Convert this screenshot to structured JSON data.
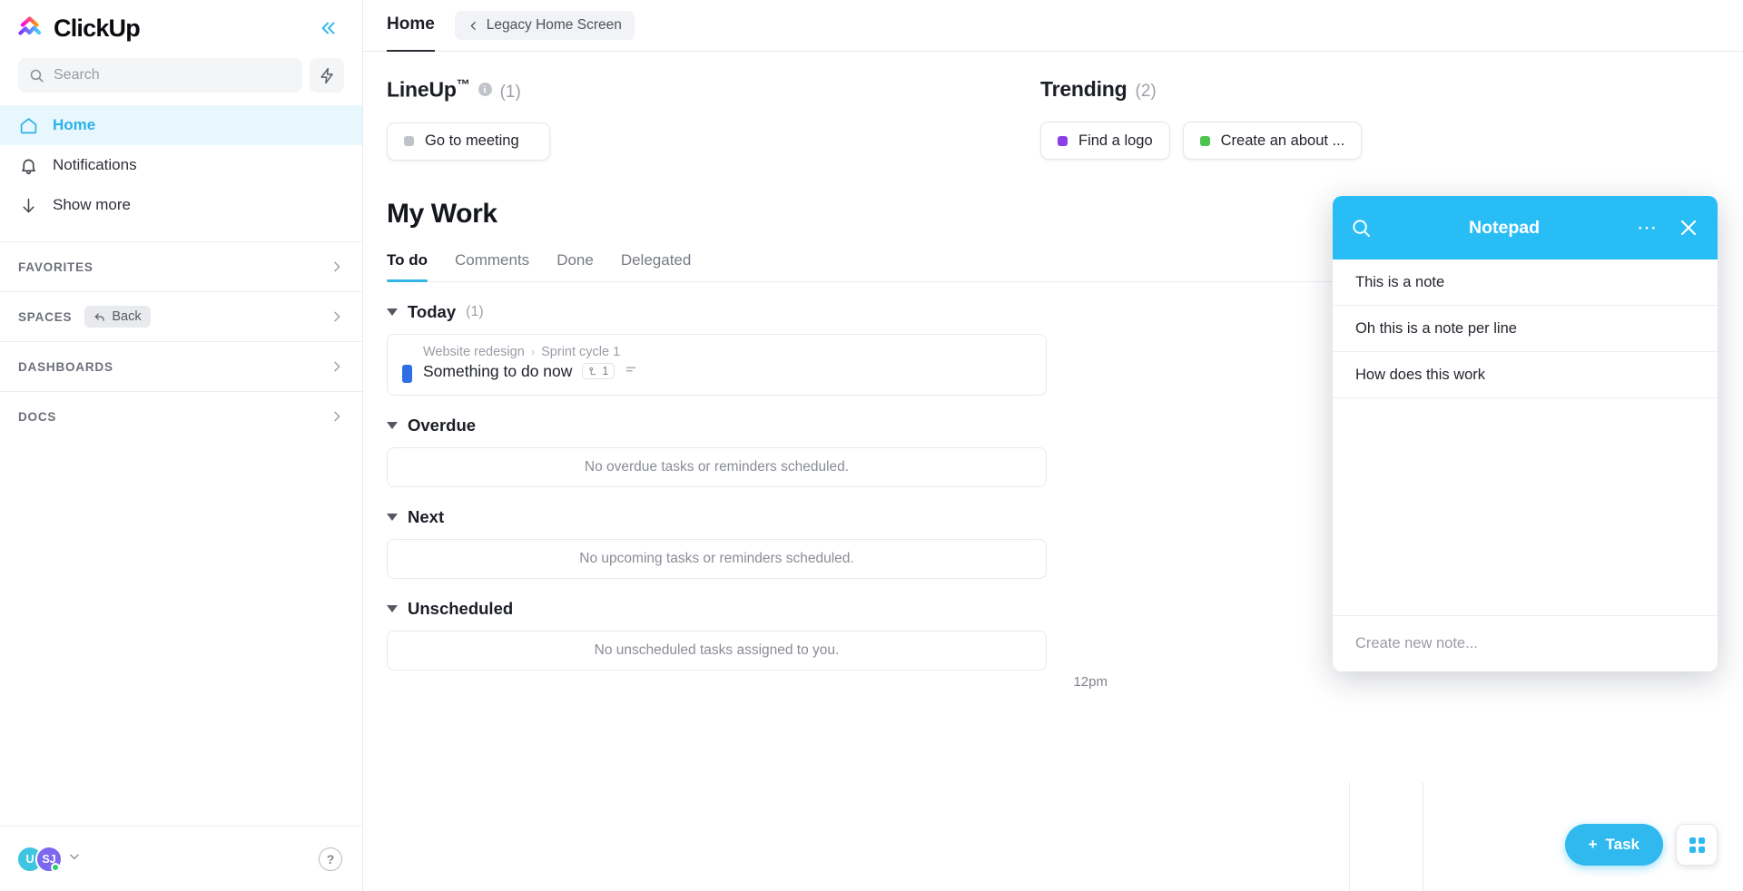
{
  "sidebar": {
    "brand": "ClickUp",
    "collapse_icon": "double-chevron-left-icon",
    "search": {
      "placeholder": "Search",
      "icon": "search-icon"
    },
    "bolt_icon": "lightning-bolt-icon",
    "nav": [
      {
        "label": "Home",
        "icon": "home-icon",
        "active": true
      },
      {
        "label": "Notifications",
        "icon": "bell-icon",
        "active": false
      },
      {
        "label": "Show more",
        "icon": "arrow-down-icon",
        "active": false
      }
    ],
    "sections": [
      {
        "title": "FAVORITES",
        "pill": null
      },
      {
        "title": "SPACES",
        "pill": "Back",
        "pill_icon": "back-arrow-icon"
      },
      {
        "title": "DASHBOARDS",
        "pill": null
      },
      {
        "title": "DOCS",
        "pill": null
      }
    ],
    "footer": {
      "avatar_1": "U",
      "avatar_2": "SJ",
      "status": "online",
      "help_label": "?"
    }
  },
  "header": {
    "tab": "Home",
    "legacy_pill": "Legacy Home Screen",
    "legacy_icon": "chevron-left-icon"
  },
  "lineup": {
    "title": "LineUp",
    "trademark": "™",
    "count": "(1)",
    "info_icon": "info-icon",
    "cards": [
      {
        "label": "Go to meeting",
        "color": "gray"
      }
    ]
  },
  "trending": {
    "title": "Trending",
    "count": "(2)",
    "cards": [
      {
        "label": "Find a logo",
        "color": "purple"
      },
      {
        "label": "Create an about ...",
        "color": "green"
      }
    ]
  },
  "mywork": {
    "title": "My Work",
    "tabs": [
      {
        "label": "To do",
        "active": true
      },
      {
        "label": "Comments",
        "active": false
      },
      {
        "label": "Done",
        "active": false
      },
      {
        "label": "Delegated",
        "active": false
      }
    ],
    "groups": [
      {
        "name": "Today",
        "count": "(1)",
        "task": {
          "crumb_space": "Website redesign",
          "crumb_sep": "›",
          "crumb_list": "Sprint cycle 1",
          "name": "Something to do now",
          "color": "blue",
          "subtask_badge": "1",
          "subtask_icon": "subtask-icon",
          "desc_icon": "description-icon"
        },
        "empty": null
      },
      {
        "name": "Overdue",
        "count": "",
        "task": null,
        "empty": "No overdue tasks or reminders scheduled."
      },
      {
        "name": "Next",
        "count": "",
        "task": null,
        "empty": "No upcoming tasks or reminders scheduled."
      },
      {
        "name": "Unscheduled",
        "count": "",
        "task": null,
        "empty": "No unscheduled tasks assigned to you."
      }
    ]
  },
  "calendar": {
    "time_label": "12pm"
  },
  "notepad": {
    "title": "Notepad",
    "search_icon": "search-icon",
    "menu_icon": "ellipsis-icon",
    "close_icon": "close-icon",
    "notes": [
      {
        "text": "This is a note"
      },
      {
        "text": "Oh this is a note per line"
      },
      {
        "text": "How does this work"
      }
    ],
    "new_note_placeholder": "Create new note..."
  },
  "floating": {
    "task_button": "Task",
    "task_plus": "+",
    "grid_icon": "app-grid-icon"
  },
  "colors": {
    "accent": "#2fb9ee",
    "notepad_header": "#29bdf5",
    "home_active_bg": "#e8f6fd",
    "home_active_text": "#2ab3e8"
  }
}
